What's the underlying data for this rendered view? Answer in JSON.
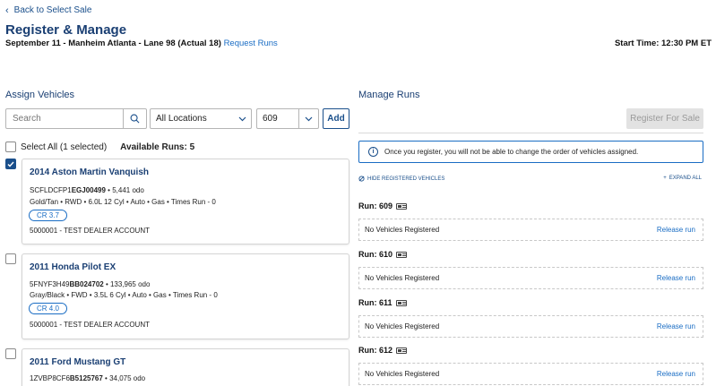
{
  "nav": {
    "back_label": "Back to Select Sale"
  },
  "header": {
    "title": "Register & Manage",
    "subtitle": "September 11 - Manheim Atlanta - Lane 98 (Actual 18)",
    "request_runs": "Request Runs",
    "start_time": "Start Time: 12:30 PM ET"
  },
  "assign": {
    "heading": "Assign Vehicles",
    "search_placeholder": "Search",
    "location_value": "All Locations",
    "run_value": "609",
    "add_label": "Add",
    "select_all": "Select All (1 selected)",
    "available_runs": "Available Runs: 5",
    "vehicles": [
      {
        "checked": true,
        "title": "2014 Aston Martin Vanquish",
        "vin_prefix": "SCFLDCFP1",
        "vin_bold": "EGJ00499",
        "odo": " • 5,441 odo",
        "specs": "Gold/Tan • RWD • 6.0L 12 Cyl • Auto • Gas • Times Run - 0",
        "cr": "CR 3.7",
        "dealer": "5000001 - TEST DEALER ACCOUNT"
      },
      {
        "checked": false,
        "title": "2011 Honda Pilot EX",
        "vin_prefix": "5FNYF3H49",
        "vin_bold": "BB024702",
        "odo": " • 133,965 odo",
        "specs": "Gray/Black • FWD • 3.5L 6 Cyl • Auto • Gas • Times Run - 0",
        "cr": "CR 4.0",
        "dealer": "5000001 - TEST DEALER ACCOUNT"
      },
      {
        "checked": false,
        "title": "2011 Ford Mustang GT",
        "vin_prefix": "1ZVBP8CF6",
        "vin_bold": "B5125767",
        "odo": " • 34,075 odo"
      }
    ]
  },
  "manage": {
    "heading": "Manage Runs",
    "register_label": "Register For Sale",
    "info_text": "Once you register, you will not be able to change the order of vehicles assigned.",
    "hide_registered": "HIDE REGISTERED VEHICLES",
    "expand_all": "EXPAND ALL",
    "runs": [
      {
        "label": "Run: 609",
        "status": "No Vehicles Registered",
        "action": "Release run"
      },
      {
        "label": "Run: 610",
        "status": "No Vehicles Registered",
        "action": "Release run"
      },
      {
        "label": "Run: 611",
        "status": "No Vehicles Registered",
        "action": "Release run"
      },
      {
        "label": "Run: 612",
        "status": "No Vehicles Registered",
        "action": "Release run"
      }
    ]
  },
  "colors": {
    "primary": "#1a4f8b",
    "link": "#1a6dc4",
    "heading": "#1a3f73"
  }
}
